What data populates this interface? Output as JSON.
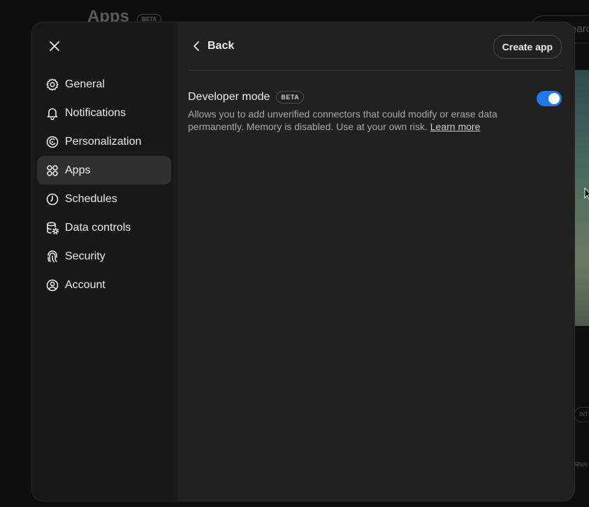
{
  "background": {
    "title": "Apps",
    "beta_badge": "BETA",
    "search_text": "Search",
    "chip_text": "INT",
    "chip2_text": "RNAI"
  },
  "sidebar": {
    "close_icon": "close-icon",
    "items": [
      {
        "label": "General",
        "icon": "gear-icon",
        "active": false
      },
      {
        "label": "Notifications",
        "icon": "bell-icon",
        "active": false
      },
      {
        "label": "Personalization",
        "icon": "personalization-icon",
        "active": false
      },
      {
        "label": "Apps",
        "icon": "apps-grid-icon",
        "active": true
      },
      {
        "label": "Schedules",
        "icon": "clock-icon",
        "active": false
      },
      {
        "label": "Data controls",
        "icon": "database-gear-icon",
        "active": false
      },
      {
        "label": "Security",
        "icon": "fingerprint-icon",
        "active": false
      },
      {
        "label": "Account",
        "icon": "user-circle-icon",
        "active": false
      }
    ]
  },
  "header": {
    "back_label": "Back",
    "create_app_label": "Create app"
  },
  "developer_mode": {
    "title": "Developer mode",
    "badge": "BETA",
    "description": "Allows you to add unverified connectors that could modify or erase data permanently. Memory is disabled. Use at your own risk.",
    "learn_more": "Learn more",
    "enabled": true
  },
  "colors": {
    "accent": "#1f7ae8",
    "modal_bg": "#212121",
    "sidebar_bg": "#181818",
    "active_item_bg": "#303030"
  }
}
